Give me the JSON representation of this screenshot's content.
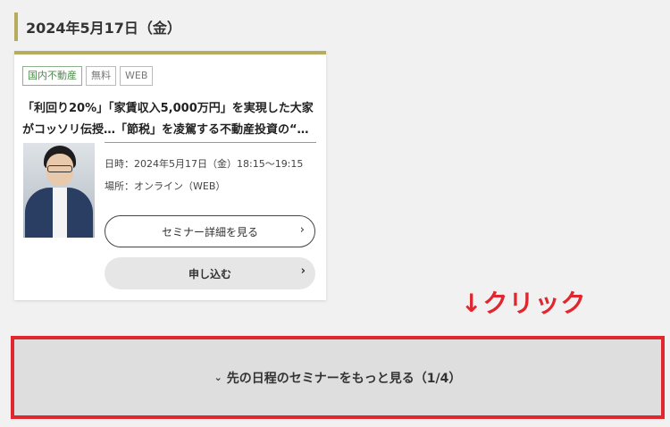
{
  "date_heading": "2024年5月17日（金）",
  "card": {
    "tags": [
      "国内不動産",
      "無料",
      "WEB"
    ],
    "title_line1": "「利回り20%」「家賃収入5,000万円」を実現した大家",
    "title_line2": "がコッソリ伝授…「節税」を凌駕する不動産投資の“…",
    "datetime": "日時：2024年5月17日（金）18:15～19:15",
    "place": "場所：オンライン（WEB）",
    "detail_button": "セミナー詳細を見る",
    "apply_button": "申し込む",
    "chevron": "›"
  },
  "annotation": "↓クリック",
  "more_button": {
    "icon": "⌄",
    "label": "先の日程のセミナーをもっと見る（1/4）"
  },
  "colors": {
    "accent": "#b5ac5e",
    "highlight": "#e0262f",
    "tag_green": "#4e8a4e"
  }
}
